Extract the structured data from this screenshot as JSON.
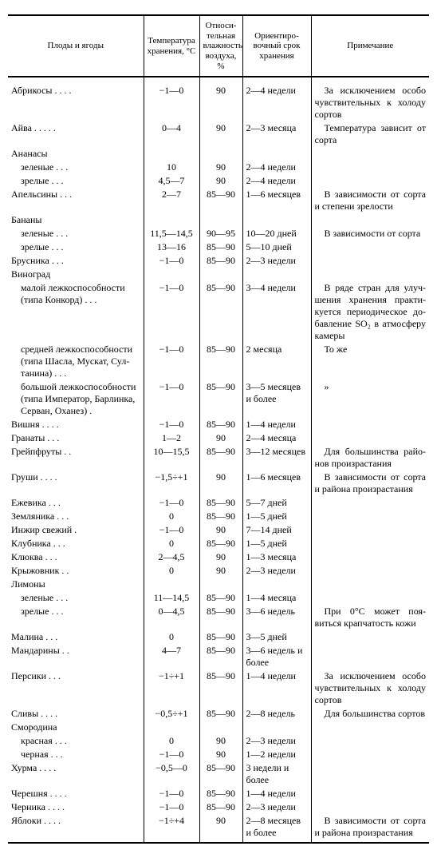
{
  "headers": {
    "name": "Плоды и ягоды",
    "temp": "Температура хранения, °С",
    "hum": "Относи­тельная влажность воздуха, %",
    "term": "Ориентиро­вочный срок хранения",
    "note": "Примечание"
  },
  "rows": [
    {
      "name": "Абрикосы .  .  .  .",
      "temp": "−1—0",
      "hum": "90",
      "term": "2—4 недели",
      "note": "За исключением особо чувствительных к холоду сортов"
    },
    {
      "name": "Айва  .  .  .  .  .",
      "temp": "0—4",
      "hum": "90",
      "term": "2—3 месяца",
      "note": "Температура зависит от сорта"
    },
    {
      "name": "Ананасы",
      "temp": "",
      "hum": "",
      "term": "",
      "note": ""
    },
    {
      "name": "зеленые  .  .  .",
      "indent": 1,
      "temp": "10",
      "hum": "90",
      "term": "2—4 недели",
      "note": ""
    },
    {
      "name": "зрелые  .  .  .",
      "indent": 1,
      "temp": "4,5—7",
      "hum": "90",
      "term": "2—4 недели",
      "note": ""
    },
    {
      "name": "Апельсины  .  .  .",
      "temp": "2—7",
      "hum": "85—90",
      "term": "1—6 месяцев",
      "note": "В зависимости от сор­та и степени зрелости"
    },
    {
      "name": "Бананы",
      "temp": "",
      "hum": "",
      "term": "",
      "note": ""
    },
    {
      "name": "зеленые  .  .  .",
      "indent": 1,
      "temp": "11,5—14,5",
      "hum": "90—95",
      "term": "10—20 дней",
      "note": "В зависимости от сор­та"
    },
    {
      "name": "зрелые  .  .  .",
      "indent": 1,
      "temp": "13—16",
      "hum": "85—90",
      "term": "5—10 дней",
      "note": ""
    },
    {
      "name": "Брусника  .  .  .",
      "temp": "−1—0",
      "hum": "85—90",
      "term": "2—3 недели",
      "note": ""
    },
    {
      "name": "Виноград",
      "temp": "",
      "hum": "",
      "term": "",
      "note": ""
    },
    {
      "name": "малой лежкоспособ­ности (типа Кон­корд)  .  .  .",
      "indent": 1,
      "temp": "−1—0",
      "hum": "85—90",
      "term": "3—4 недели",
      "note": "В ряде стран для улуч­шения хранения практи­куется периодическое до­бавление SO₂ в атмосфе­ру камеры"
    },
    {
      "name": "средней лежкоспособ­ности (типа Шас­ла, Мускат, Сул­танина)  .  .  .",
      "indent": 1,
      "temp": "−1—0",
      "hum": "85—90",
      "term": "2 месяца",
      "note": "То же"
    },
    {
      "name": "большой лежкоспо­собности (типа Им­ператор, Барлинка, Серван, Оханез)  .",
      "indent": 1,
      "temp": "−1—0",
      "hum": "85—90",
      "term": "3—5 меся­цев и более",
      "note": "»"
    },
    {
      "name": "Вишня  .  .  .  .",
      "temp": "−1—0",
      "hum": "85—90",
      "term": "1—4 недели",
      "note": ""
    },
    {
      "name": "Гранаты  .  .  .",
      "temp": "1—2",
      "hum": "90",
      "term": "2—4 месяца",
      "note": ""
    },
    {
      "name": "Грейпфруты  .  .",
      "temp": "10—15,5",
      "hum": "85—90",
      "term": "3—12 меся­цев",
      "note": "Для большинства райо­нов произрастания"
    },
    {
      "name": "Груши .  .  .  .",
      "temp": "−1,5÷+1",
      "hum": "90",
      "term": "1—6 меся­цев",
      "note": "В зависимости от сорта и района произрастания"
    },
    {
      "name": "Ежевика  .  .  .",
      "temp": "−1—0",
      "hum": "85—90",
      "term": "5—7 дней",
      "note": ""
    },
    {
      "name": "Земляника .  .  .",
      "temp": "0",
      "hum": "85—90",
      "term": "1—5 дней",
      "note": ""
    },
    {
      "name": "Инжир свежий  .",
      "temp": "−1—0",
      "hum": "90",
      "term": "7—14 дней",
      "note": ""
    },
    {
      "name": "Клубника  .  .  .",
      "temp": "0",
      "hum": "85—90",
      "term": "1—5 дней",
      "note": ""
    },
    {
      "name": "Клюква  .  .  .",
      "temp": "2—4,5",
      "hum": "90",
      "term": "1—3 месяца",
      "note": ""
    },
    {
      "name": "Крыжовник  .  .",
      "temp": "0",
      "hum": "90",
      "term": "2—3 недели",
      "note": ""
    },
    {
      "name": "Лимоны",
      "temp": "",
      "hum": "",
      "term": "",
      "note": ""
    },
    {
      "name": "зеленые  .  .  .",
      "indent": 1,
      "temp": "11—14,5",
      "hum": "85—90",
      "term": "1—4 месяца",
      "note": ""
    },
    {
      "name": "зрелые  .  .  .",
      "indent": 1,
      "temp": "0—4,5",
      "hum": "85—90",
      "term": "3—6 недель",
      "note": "При 0°С может поя­виться крапчатость кожи"
    },
    {
      "name": "Малина  .  .  .",
      "temp": "0",
      "hum": "85—90",
      "term": "3—5 дней",
      "note": ""
    },
    {
      "name": "Мандарины  .  .",
      "temp": "4—7",
      "hum": "85—90",
      "term": "3—6 недель и более",
      "note": ""
    },
    {
      "name": "Персики  .  .  .",
      "temp": "−1÷+1",
      "hum": "85—90",
      "term": "1—4 недели",
      "note": "За исключением особо чувствительных к холоду сортов"
    },
    {
      "name": "Сливы  .  .  .  .",
      "temp": "−0,5÷+1",
      "hum": "85—90",
      "term": "2—8 недель",
      "note": "Для большинства сор­тов"
    },
    {
      "name": "Смородина",
      "temp": "",
      "hum": "",
      "term": "",
      "note": ""
    },
    {
      "name": "красная  .  .  .",
      "indent": 1,
      "temp": "0",
      "hum": "90",
      "term": "2—3 недели",
      "note": ""
    },
    {
      "name": "черная  .  .  .",
      "indent": 1,
      "temp": "−1—0",
      "hum": "90",
      "term": "1—2 недели",
      "note": ""
    },
    {
      "name": "Хурма  .  .  .  .",
      "temp": "−0,5—0",
      "hum": "85—90",
      "term": "3 недели и более",
      "note": ""
    },
    {
      "name": "Черешня .  .  .  .",
      "temp": "−1—0",
      "hum": "85—90",
      "term": "1—4 недели",
      "note": ""
    },
    {
      "name": "Черника .  .  .  .",
      "temp": "−1—0",
      "hum": "85—90",
      "term": "2—3 недели",
      "note": ""
    },
    {
      "name": "Яблоки  .  .  .  .",
      "temp": "−1÷+4",
      "hum": "90",
      "term": "2—8 меся­цев и более",
      "note": "В зависимости от сор­та и района произраста­ния"
    }
  ]
}
